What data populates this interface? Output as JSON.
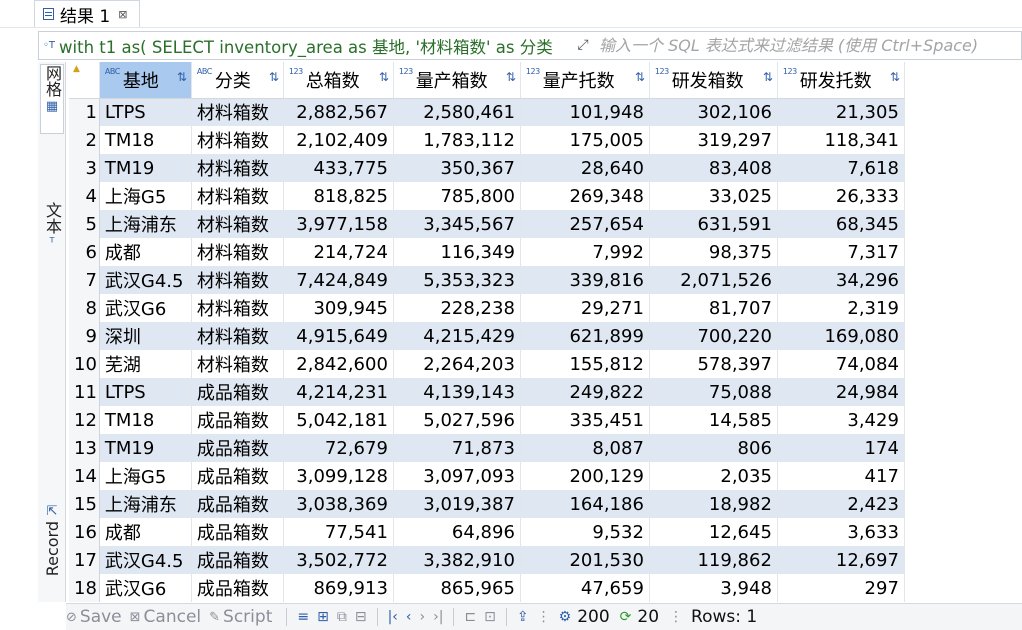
{
  "tab": {
    "title": "结果 1",
    "close": "⊠"
  },
  "filter": {
    "query": "with t1 as( SELECT inventory_area as 基地, '材料箱数' as 分类",
    "placeholder": "输入一个 SQL 表达式来过滤结果 (使用 Ctrl+Space)"
  },
  "side_tabs": {
    "grid": "网格",
    "text": "文本",
    "record": "Record"
  },
  "columns": [
    {
      "type": "ABC",
      "name": "基地",
      "align": "left"
    },
    {
      "type": "ABC",
      "name": "分类",
      "align": "left"
    },
    {
      "type": "123",
      "name": "总箱数",
      "align": "right"
    },
    {
      "type": "123",
      "name": "量产箱数",
      "align": "right"
    },
    {
      "type": "123",
      "name": "量产托数",
      "align": "right"
    },
    {
      "type": "123",
      "name": "研发箱数",
      "align": "right"
    },
    {
      "type": "123",
      "name": "研发托数",
      "align": "right"
    }
  ],
  "rows": [
    [
      "1",
      "LTPS",
      "材料箱数",
      "2,882,567",
      "2,580,461",
      "101,948",
      "302,106",
      "21,305"
    ],
    [
      "2",
      "TM18",
      "材料箱数",
      "2,102,409",
      "1,783,112",
      "175,005",
      "319,297",
      "118,341"
    ],
    [
      "3",
      "TM19",
      "材料箱数",
      "433,775",
      "350,367",
      "28,640",
      "83,408",
      "7,618"
    ],
    [
      "4",
      "上海G5",
      "材料箱数",
      "818,825",
      "785,800",
      "269,348",
      "33,025",
      "26,333"
    ],
    [
      "5",
      "上海浦东",
      "材料箱数",
      "3,977,158",
      "3,345,567",
      "257,654",
      "631,591",
      "68,345"
    ],
    [
      "6",
      "成都",
      "材料箱数",
      "214,724",
      "116,349",
      "7,992",
      "98,375",
      "7,317"
    ],
    [
      "7",
      "武汉G4.5",
      "材料箱数",
      "7,424,849",
      "5,353,323",
      "339,816",
      "2,071,526",
      "34,296"
    ],
    [
      "8",
      "武汉G6",
      "材料箱数",
      "309,945",
      "228,238",
      "29,271",
      "81,707",
      "2,319"
    ],
    [
      "9",
      "深圳",
      "材料箱数",
      "4,915,649",
      "4,215,429",
      "621,899",
      "700,220",
      "169,080"
    ],
    [
      "10",
      "芜湖",
      "材料箱数",
      "2,842,600",
      "2,264,203",
      "155,812",
      "578,397",
      "74,084"
    ],
    [
      "11",
      "LTPS",
      "成品箱数",
      "4,214,231",
      "4,139,143",
      "249,822",
      "75,088",
      "24,984"
    ],
    [
      "12",
      "TM18",
      "成品箱数",
      "5,042,181",
      "5,027,596",
      "335,451",
      "14,585",
      "3,429"
    ],
    [
      "13",
      "TM19",
      "成品箱数",
      "72,679",
      "71,873",
      "8,087",
      "806",
      "174"
    ],
    [
      "14",
      "上海G5",
      "成品箱数",
      "3,099,128",
      "3,097,093",
      "200,129",
      "2,035",
      "417"
    ],
    [
      "15",
      "上海浦东",
      "成品箱数",
      "3,038,369",
      "3,019,387",
      "164,186",
      "18,982",
      "2,423"
    ],
    [
      "16",
      "成都",
      "成品箱数",
      "77,541",
      "64,896",
      "9,532",
      "12,645",
      "3,633"
    ],
    [
      "17",
      "武汉G4.5",
      "成品箱数",
      "3,502,772",
      "3,382,910",
      "201,530",
      "119,862",
      "12,697"
    ],
    [
      "18",
      "武汉G6",
      "成品箱数",
      "869,913",
      "865,965",
      "47,659",
      "3,948",
      "297"
    ]
  ],
  "toolbar": {
    "save": "Save",
    "cancel": "Cancel",
    "script": "Script",
    "fetch_size": "200",
    "refresh_value": "20",
    "rows_label": "Rows: 1"
  },
  "colors": {
    "header_selected": "#a9c9ee",
    "row_stripe": "#dfe7f2",
    "accent": "#2f5fa8",
    "query_text": "#2a6f2a"
  }
}
